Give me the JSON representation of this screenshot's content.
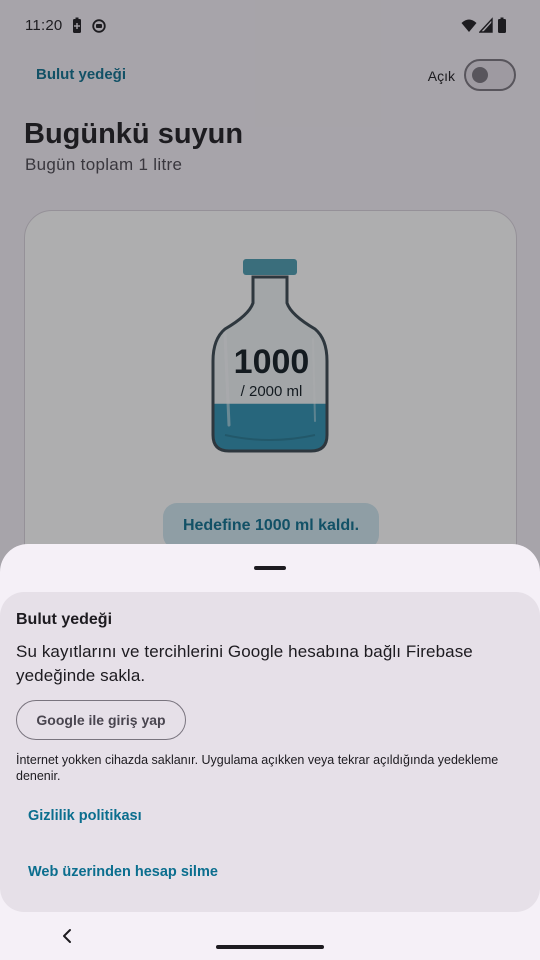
{
  "status_bar": {
    "time": "11:20",
    "left_icons": [
      "battery-saver-icon",
      "notification-icon"
    ],
    "right_icons": [
      "wifi-icon",
      "cellular-signal-icon",
      "battery-icon"
    ]
  },
  "top_bar": {
    "backup_link": "Bulut yedeği",
    "toggle_label": "Açık",
    "toggle_on": false
  },
  "page": {
    "title": "Bugünkü suyun",
    "subtitle": "Bugün toplam 1 litre"
  },
  "water_card": {
    "amount": "1000",
    "goal": "/ 2000 ml",
    "fill_fraction": 0.5,
    "remaining": "Hedefine 1000 ml kaldı."
  },
  "sheet": {
    "title": "Bulut yedeği",
    "description": "Su kayıtlarını ve tercihlerini Google hesabına bağlı Firebase yedeğinde sakla.",
    "google_button": "Google ile giriş yap",
    "offline_note": "İnternet yokken cihazda saklanır. Uygulama açıkken veya tekrar açıldığında yedekleme denenir.",
    "privacy_link": "Gizlilik politikası",
    "delete_link": "Web üzerinden hesap silme"
  },
  "colors": {
    "accent": "#0b6e8e",
    "water": "#2d8fb0",
    "bottle_cap": "#4a9bb0"
  }
}
